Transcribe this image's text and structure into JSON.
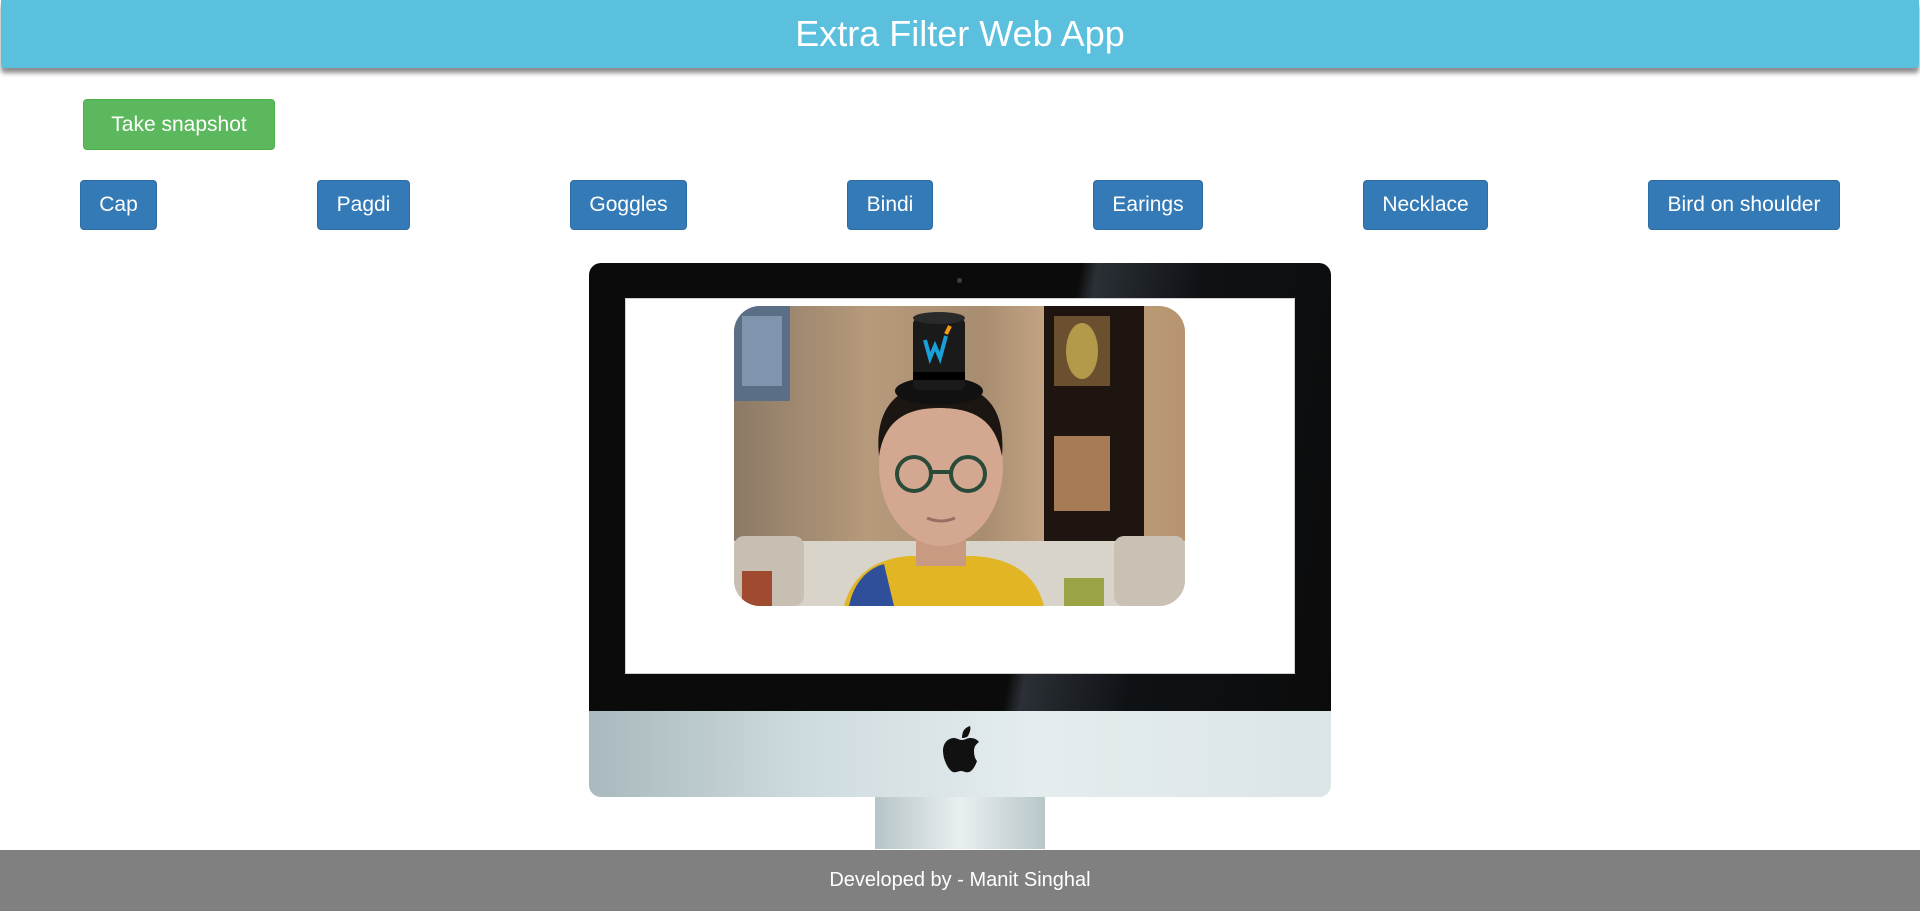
{
  "header": {
    "title": "Extra Filter Web App"
  },
  "actions": {
    "snapshot_label": "Take snapshot"
  },
  "filters": [
    {
      "label": "Cap"
    },
    {
      "label": "Pagdi"
    },
    {
      "label": "Goggles"
    },
    {
      "label": "Bindi"
    },
    {
      "label": "Earings"
    },
    {
      "label": "Necklace"
    },
    {
      "label": "Bird on shoulder"
    }
  ],
  "footer": {
    "text": "Developed by - Manit Singhal"
  },
  "icons": {
    "device": "apple-icon",
    "overlay": "top-hat-icon"
  },
  "colors": {
    "header": "#5bc0de",
    "success_button": "#5cb85c",
    "primary_button": "#337ab7",
    "footer": "#808080"
  }
}
